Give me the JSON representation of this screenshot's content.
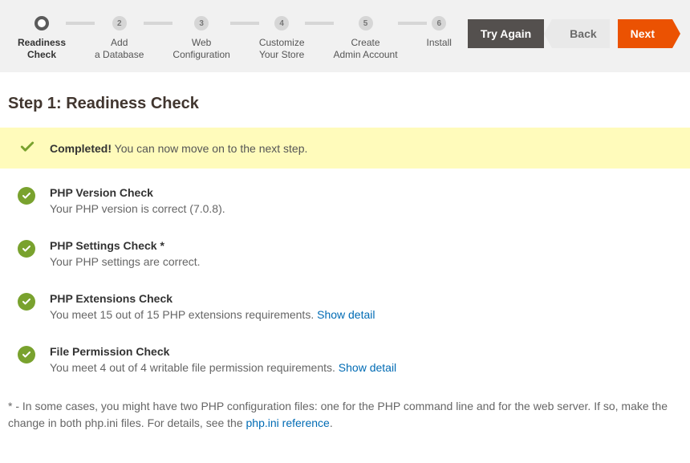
{
  "stepper": {
    "steps": [
      {
        "num": "",
        "label": "Readiness\nCheck",
        "active": true
      },
      {
        "num": "2",
        "label": "Add\na Database"
      },
      {
        "num": "3",
        "label": "Web\nConfiguration"
      },
      {
        "num": "4",
        "label": "Customize\nYour Store"
      },
      {
        "num": "5",
        "label": "Create\nAdmin Account"
      },
      {
        "num": "6",
        "label": "Install"
      }
    ]
  },
  "buttons": {
    "try_again": "Try Again",
    "back": "Back",
    "next": "Next"
  },
  "page_title": "Step 1: Readiness Check",
  "alert": {
    "strong": "Completed!",
    "rest": " You can now move on to the next step."
  },
  "checks": [
    {
      "title": "PHP Version Check",
      "desc": "Your PHP version is correct (7.0.8).",
      "link": ""
    },
    {
      "title": "PHP Settings Check *",
      "desc": "Your PHP settings are correct.",
      "link": ""
    },
    {
      "title": "PHP Extensions Check",
      "desc": "You meet 15 out of 15 PHP extensions requirements. ",
      "link": "Show detail"
    },
    {
      "title": "File Permission Check",
      "desc": "You meet 4 out of 4 writable file permission requirements. ",
      "link": "Show detail"
    }
  ],
  "footnote": {
    "pre": "* - In some cases, you might have two PHP configuration files: one for the PHP command line and for the web server. If so, make the change in both php.ini files. For details, see the ",
    "link": "php.ini reference",
    "post": "."
  }
}
